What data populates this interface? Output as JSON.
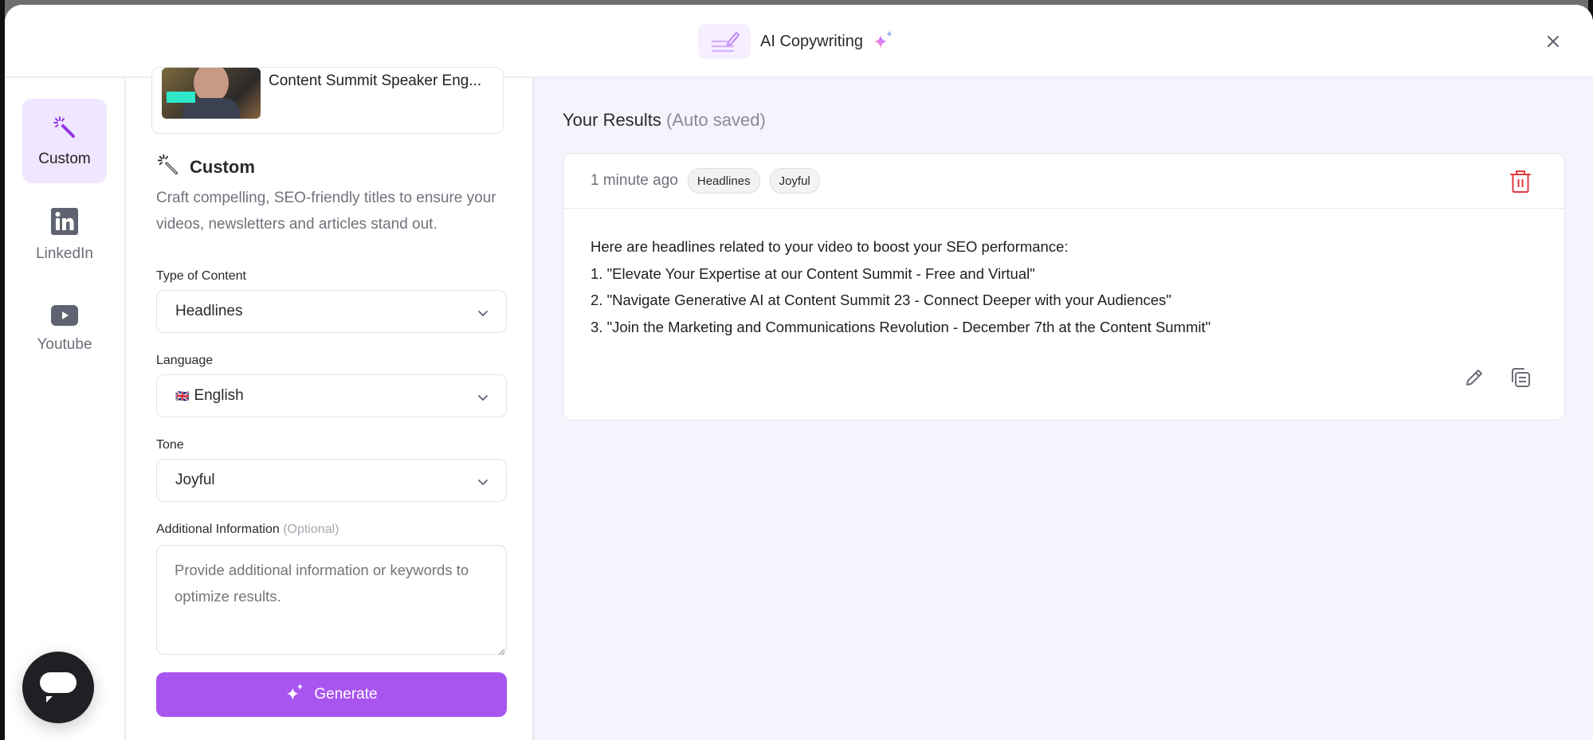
{
  "header": {
    "title": "AI Copywriting",
    "logo_icon": "pencil-lines-icon",
    "sparkle_icon": "sparkles-icon",
    "close_icon": "close-icon"
  },
  "sidebar": {
    "items": [
      {
        "label": "Custom",
        "icon": "magic-wand-icon",
        "active": true
      },
      {
        "label": "LinkedIn",
        "icon": "linkedin-icon",
        "active": false
      },
      {
        "label": "Youtube",
        "icon": "youtube-icon",
        "active": false
      }
    ],
    "chat_icon": "chat-bubble-icon"
  },
  "video": {
    "title": "Content Summit Speaker Eng..."
  },
  "form": {
    "section_title": "Custom",
    "section_description": "Craft compelling, SEO-friendly titles to ensure your videos, newsletters and articles stand out.",
    "type_of_content": {
      "label": "Type of Content",
      "value": "Headlines"
    },
    "language": {
      "label": "Language",
      "value": "English",
      "flag": "🇬🇧"
    },
    "tone": {
      "label": "Tone",
      "value": "Joyful"
    },
    "additional_info": {
      "label": "Additional Information",
      "optional": "(Optional)",
      "placeholder": "Provide additional information or keywords to optimize results.",
      "value": ""
    },
    "generate_label": "Generate"
  },
  "results": {
    "title": "Your Results",
    "subtitle": "(Auto saved)",
    "items": [
      {
        "timestamp": "1 minute ago",
        "tags": [
          "Headlines",
          "Joyful"
        ],
        "lines": [
          "Here are headlines related to your video to boost your SEO performance:",
          "1. \"Elevate Your Expertise at our Content Summit - Free and Virtual\"",
          "2. \"Navigate Generative AI at Content Summit 23 - Connect Deeper with your Audiences\"",
          "3. \"Join the Marketing and Communications Revolution - December 7th at the Content Summit\""
        ]
      }
    ]
  },
  "colors": {
    "accent": "#a855f0",
    "accent_light": "#efe6ff",
    "results_bg": "#f6f3fd",
    "danger": "#e0393e"
  }
}
